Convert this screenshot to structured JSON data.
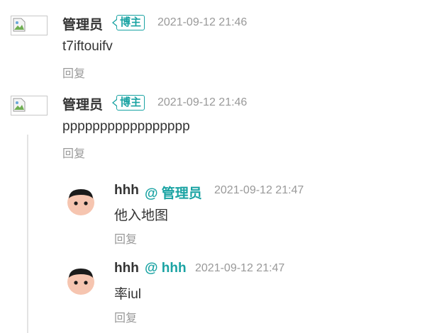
{
  "comments": [
    {
      "author": "管理员",
      "badge": "博主",
      "time": "2021-09-12 21:46",
      "content": "t7iftouifv",
      "reply_label": "回复"
    },
    {
      "author": "管理员",
      "badge": "博主",
      "time": "2021-09-12 21:46",
      "content": "ppppppppppppppppp",
      "reply_label": "回复",
      "replies": [
        {
          "author": "hhh",
          "mention": "@ 管理员",
          "time": "2021-09-12 21:47",
          "content": "他入地图",
          "reply_label": "回复"
        },
        {
          "author": "hhh",
          "mention": "@ hhh",
          "time": "2021-09-12 21:47",
          "content": "率iul",
          "reply_label": "回复"
        }
      ]
    }
  ],
  "colors": {
    "accent": "#1aa3a3",
    "muted": "#999999",
    "text": "#333333"
  },
  "icons": {
    "avatar_broken": "broken-image-icon",
    "avatar_user": "cartoon-face-icon"
  }
}
